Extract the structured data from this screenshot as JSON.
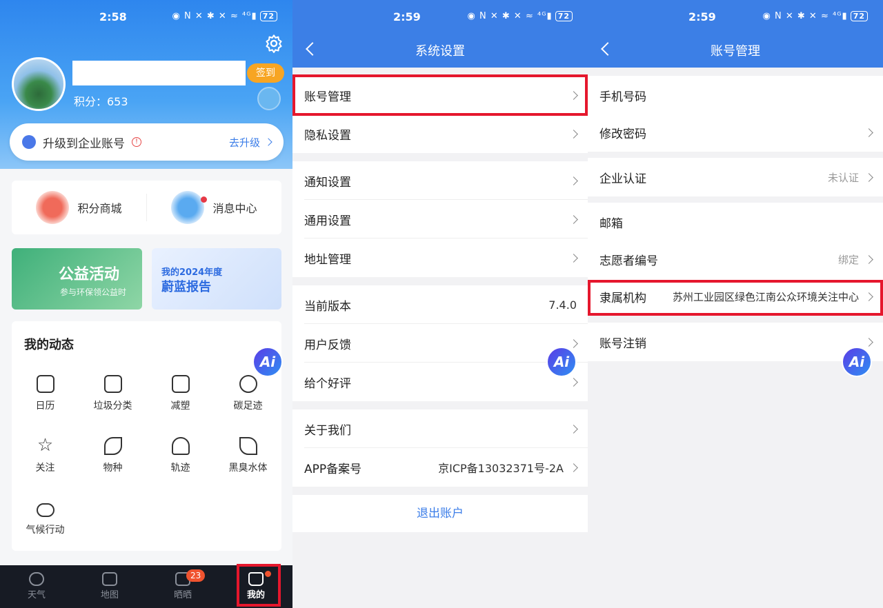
{
  "screen1": {
    "status_time": "2:58",
    "status_icons": "◉ N ✕ ✱ ✕ ≈ ⁴ᴳ▮",
    "battery": "72",
    "sign_in": "签到",
    "points": "积分：653",
    "upgrade": {
      "label": "升级到企业账号",
      "action": "去升级"
    },
    "quick": [
      {
        "label": "积分商城"
      },
      {
        "label": "消息中心"
      }
    ],
    "banner1": {
      "title": "公益活动",
      "subtitle": "参与环保领公益时"
    },
    "banner2": {
      "line1": "我的2024年度",
      "line2": "蔚蓝报告"
    },
    "dynamics_title": "我的动态",
    "grid": [
      "日历",
      "垃圾分类",
      "减塑",
      "碳足迹",
      "关注",
      "物种",
      "轨迹",
      "黑臭水体",
      "气候行动"
    ],
    "tabs": [
      "天气",
      "地图",
      "晒晒",
      "我的"
    ],
    "tab_badge": "23",
    "ai_label": "Ai"
  },
  "screen2": {
    "status_time": "2:59",
    "battery": "72",
    "title": "系统设置",
    "rows": [
      {
        "label": "账号管理"
      },
      {
        "label": "隐私设置"
      },
      {
        "label": "通知设置"
      },
      {
        "label": "通用设置"
      },
      {
        "label": "地址管理"
      },
      {
        "label": "当前版本",
        "value": "7.4.0"
      },
      {
        "label": "用户反馈"
      },
      {
        "label": "给个好评"
      },
      {
        "label": "关于我们"
      },
      {
        "label": "APP备案号",
        "value": "京ICP备13032371号-2A"
      }
    ],
    "logout": "退出账户"
  },
  "screen3": {
    "status_time": "2:59",
    "battery": "72",
    "title": "账号管理",
    "rows": [
      {
        "label": "手机号码"
      },
      {
        "label": "修改密码"
      },
      {
        "label": "企业认证",
        "value": "未认证"
      },
      {
        "label": "邮箱"
      },
      {
        "label": "志愿者编号",
        "value": "绑定"
      },
      {
        "label": "隶属机构",
        "value": "苏州工业园区绿色江南公众环境关注中心"
      },
      {
        "label": "账号注销"
      }
    ]
  },
  "colors": {
    "primary": "#3c7fe6",
    "highlight": "#e5172d",
    "orange": "#f7a523"
  }
}
